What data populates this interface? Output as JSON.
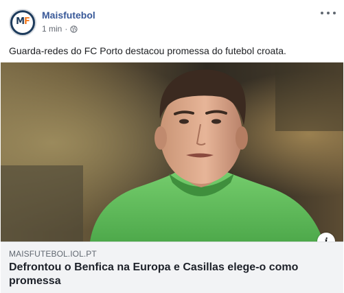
{
  "post": {
    "page_name": "Maisfutebol",
    "timestamp": "1 min",
    "separator": "·",
    "privacy_icon": "globe-icon",
    "more_icon": "more-options-icon",
    "avatar_text_1": "M",
    "avatar_text_2": "F",
    "caption": "Guarda-redes do FC Porto destacou promessa do futebol croata."
  },
  "link_preview": {
    "domain": "MAISFUTEBOL.IOL.PT",
    "headline": "Defrontou o Benfica na Europa e Casillas elege-o como promessa",
    "info_icon": "info-icon",
    "info_label": "i"
  },
  "colors": {
    "accent": "#385898",
    "brand_navy": "#1d3b5c",
    "brand_orange": "#f47b20",
    "jersey_green": "#5dbb5a"
  }
}
